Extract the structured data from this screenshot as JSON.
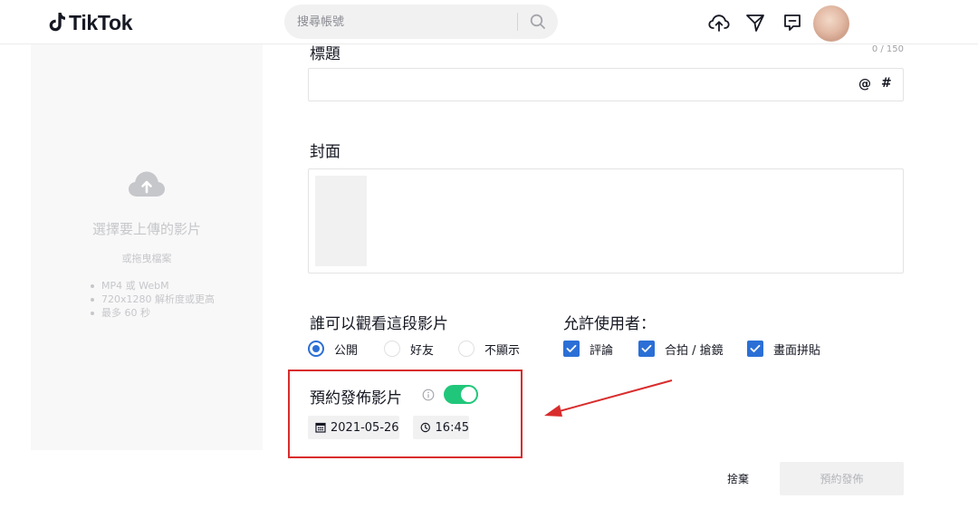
{
  "header": {
    "logo_text": "TikTok",
    "search_placeholder": "搜尋帳號",
    "icons": [
      "upload-cloud-icon",
      "send-icon",
      "inbox-message-icon"
    ],
    "accent": "#161823"
  },
  "upload_panel": {
    "title": "選擇要上傳的影片",
    "subtitle": "或拖曳檔案",
    "requirements": [
      "MP4 或 WebM",
      "720x1280 解析度或更高",
      "最多 60 秒"
    ]
  },
  "caption": {
    "label": "標題",
    "counter": "0 / 150",
    "value": "",
    "mention_symbol": "@",
    "hashtag_symbol": "#"
  },
  "cover": {
    "label": "封面"
  },
  "visibility": {
    "label": "誰可以觀看這段影片",
    "options": [
      {
        "label": "公開",
        "selected": true
      },
      {
        "label": "好友",
        "selected": false
      },
      {
        "label": "不顯示",
        "selected": false
      }
    ],
    "selected_color": "#2b6fd6"
  },
  "allow": {
    "label": "允許使用者：",
    "options": [
      {
        "label": "評論",
        "checked": true
      },
      {
        "label": "合拍 / 搶鏡",
        "checked": true
      },
      {
        "label": "畫面拼貼",
        "checked": true
      }
    ]
  },
  "schedule": {
    "label": "預約發佈影片",
    "enabled": true,
    "toggle_color": "#20c77a",
    "date": "2021-05-26",
    "time": "16:45",
    "highlight_color": "#d92c2c"
  },
  "actions": {
    "discard_label": "捨棄",
    "submit_label": "預約發佈"
  }
}
